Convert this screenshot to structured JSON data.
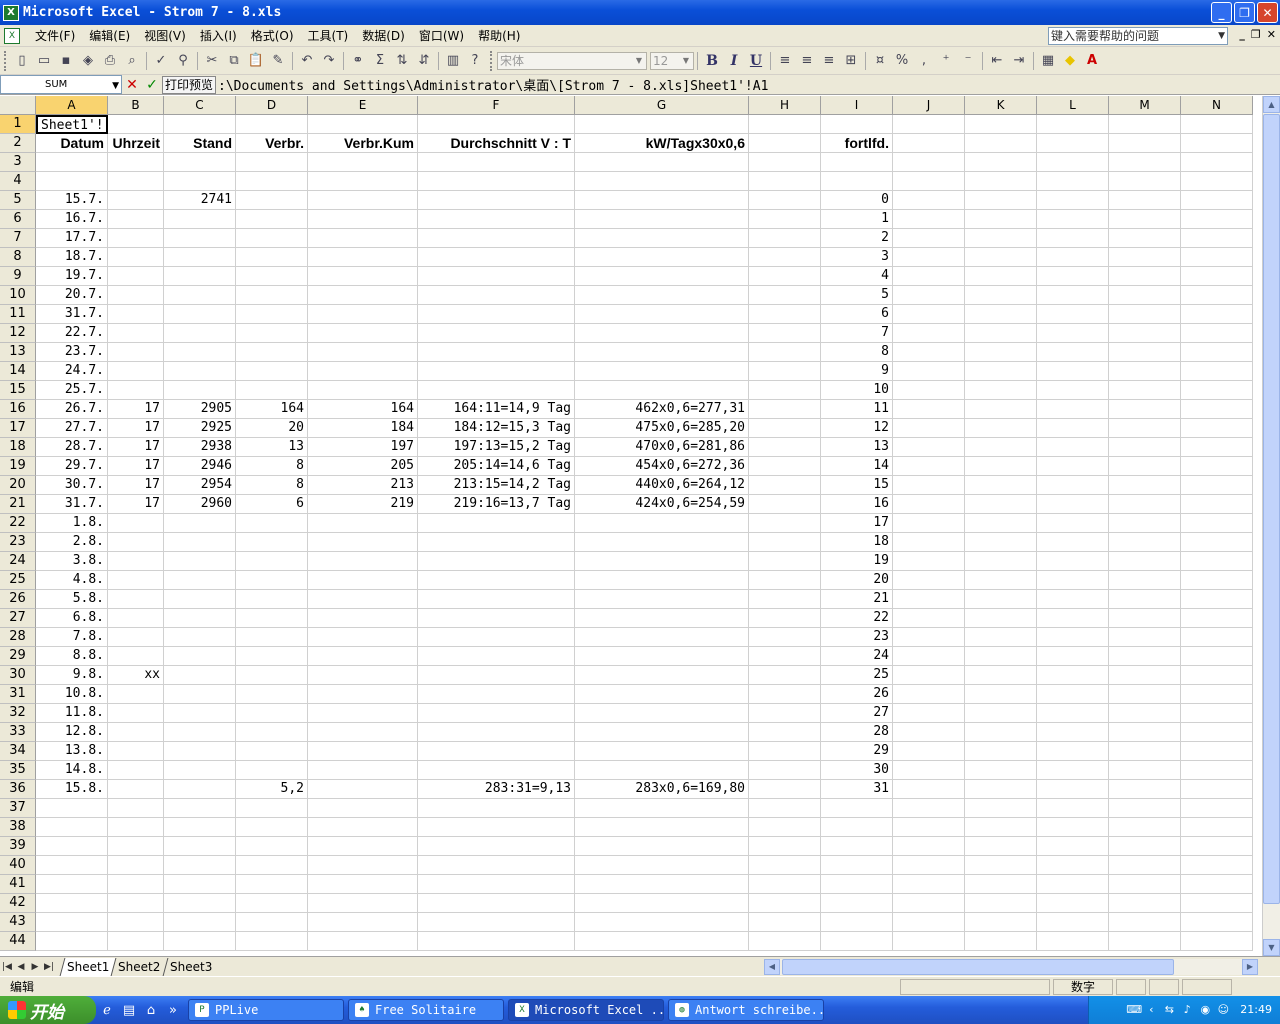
{
  "window": {
    "title": "Microsoft Excel - Strom 7 - 8.xls",
    "app_icon": "excel-icon"
  },
  "menu": {
    "items": [
      "文件(F)",
      "编辑(E)",
      "视图(V)",
      "插入(I)",
      "格式(O)",
      "工具(T)",
      "数据(D)",
      "窗口(W)",
      "帮助(H)"
    ],
    "help_placeholder": "键入需要帮助的问题"
  },
  "toolbar": {
    "font_name": "宋体",
    "font_size": "12",
    "bold": "B",
    "italic": "I",
    "underline": "U",
    "percent": "%"
  },
  "formula_bar": {
    "name_box": "SUM",
    "cancel": "✕",
    "enter": "✓",
    "preview_label": "打印预览",
    "formula": ":\\Documents and Settings\\Administrator\\桌面\\[Strom 7 - 8.xls]Sheet1'!A1"
  },
  "columns": [
    "A",
    "B",
    "C",
    "D",
    "E",
    "F",
    "G",
    "H",
    "I",
    "J",
    "K",
    "L",
    "M",
    "N"
  ],
  "active_column": "A",
  "active_row": "1",
  "rows": [
    {
      "n": "1",
      "cells": {
        "A": "Sheet1'!"
      }
    },
    {
      "n": "2",
      "header": true,
      "cells": {
        "A": "Datum",
        "B": "Uhrzeit",
        "C": "Stand",
        "D": "Verbr.",
        "E": "Verbr.Kum",
        "F": "Durchschnitt V : T",
        "G": "kW/Tagx30x0,6",
        "I": "fortlfd."
      }
    },
    {
      "n": "3",
      "cells": {}
    },
    {
      "n": "4",
      "cells": {}
    },
    {
      "n": "5",
      "cells": {
        "A": "15.7.",
        "C": "2741",
        "I": "0"
      }
    },
    {
      "n": "6",
      "cells": {
        "A": "16.7.",
        "I": "1"
      }
    },
    {
      "n": "7",
      "cells": {
        "A": "17.7.",
        "I": "2"
      }
    },
    {
      "n": "8",
      "cells": {
        "A": "18.7.",
        "I": "3"
      }
    },
    {
      "n": "9",
      "cells": {
        "A": "19.7.",
        "I": "4"
      }
    },
    {
      "n": "10",
      "cells": {
        "A": "20.7.",
        "I": "5"
      }
    },
    {
      "n": "11",
      "cells": {
        "A": "31.7.",
        "I": "6"
      }
    },
    {
      "n": "12",
      "cells": {
        "A": "22.7.",
        "I": "7"
      }
    },
    {
      "n": "13",
      "cells": {
        "A": "23.7.",
        "I": "8"
      }
    },
    {
      "n": "14",
      "cells": {
        "A": "24.7.",
        "I": "9"
      }
    },
    {
      "n": "15",
      "cells": {
        "A": "25.7.",
        "I": "10"
      }
    },
    {
      "n": "16",
      "cells": {
        "A": "26.7.",
        "B": "17",
        "C": "2905",
        "D": "164",
        "E": "164",
        "F": "164:11=14,9 Tag",
        "G": "462x0,6=277,31",
        "I": "11"
      }
    },
    {
      "n": "17",
      "cells": {
        "A": "27.7.",
        "B": "17",
        "C": "2925",
        "D": "20",
        "E": "184",
        "F": "184:12=15,3 Tag",
        "G": "475x0,6=285,20",
        "I": "12"
      }
    },
    {
      "n": "18",
      "cells": {
        "A": "28.7.",
        "B": "17",
        "C": "2938",
        "D": "13",
        "E": "197",
        "F": "197:13=15,2 Tag",
        "G": "470x0,6=281,86",
        "I": "13"
      }
    },
    {
      "n": "19",
      "cells": {
        "A": "29.7.",
        "B": "17",
        "C": "2946",
        "D": "8",
        "E": "205",
        "F": "205:14=14,6 Tag",
        "G": "454x0,6=272,36",
        "I": "14"
      }
    },
    {
      "n": "20",
      "cells": {
        "A": "30.7.",
        "B": "17",
        "C": "2954",
        "D": "8",
        "E": "213",
        "F": "213:15=14,2 Tag",
        "G": "440x0,6=264,12",
        "I": "15"
      }
    },
    {
      "n": "21",
      "cells": {
        "A": "31.7.",
        "B": "17",
        "C": "2960",
        "D": "6",
        "E": "219",
        "F": "219:16=13,7 Tag",
        "G": "424x0,6=254,59",
        "I": "16"
      }
    },
    {
      "n": "22",
      "cells": {
        "A": "1.8.",
        "I": "17"
      }
    },
    {
      "n": "23",
      "cells": {
        "A": "2.8.",
        "I": "18"
      }
    },
    {
      "n": "24",
      "cells": {
        "A": "3.8.",
        "I": "19"
      }
    },
    {
      "n": "25",
      "cells": {
        "A": "4.8.",
        "I": "20"
      }
    },
    {
      "n": "26",
      "cells": {
        "A": "5.8.",
        "I": "21"
      }
    },
    {
      "n": "27",
      "cells": {
        "A": "6.8.",
        "I": "22"
      }
    },
    {
      "n": "28",
      "cells": {
        "A": "7.8.",
        "I": "23"
      }
    },
    {
      "n": "29",
      "cells": {
        "A": "8.8.",
        "I": "24"
      }
    },
    {
      "n": "30",
      "cells": {
        "A": "9.8.",
        "B": "xx",
        "I": "25"
      }
    },
    {
      "n": "31",
      "cells": {
        "A": "10.8.",
        "I": "26"
      }
    },
    {
      "n": "32",
      "cells": {
        "A": "11.8.",
        "I": "27"
      }
    },
    {
      "n": "33",
      "cells": {
        "A": "12.8.",
        "I": "28"
      }
    },
    {
      "n": "34",
      "cells": {
        "A": "13.8.",
        "I": "29"
      }
    },
    {
      "n": "35",
      "cells": {
        "A": "14.8.",
        "I": "30"
      }
    },
    {
      "n": "36",
      "cells": {
        "A": "15.8.",
        "D": "5,2",
        "F": "283:31=9,13",
        "G": "283x0,6=169,80",
        "I": "31"
      }
    },
    {
      "n": "37",
      "cells": {}
    },
    {
      "n": "38",
      "cells": {}
    },
    {
      "n": "39",
      "cells": {}
    },
    {
      "n": "40",
      "cells": {}
    },
    {
      "n": "41",
      "cells": {}
    },
    {
      "n": "42",
      "cells": {}
    },
    {
      "n": "43",
      "cells": {}
    },
    {
      "n": "44",
      "cells": {}
    }
  ],
  "sheets": [
    "Sheet1",
    "Sheet2",
    "Sheet3"
  ],
  "active_sheet": "Sheet1",
  "status": {
    "mode": "编辑",
    "num": "数字"
  },
  "taskbar": {
    "start": "开始",
    "tasks": [
      {
        "label": "PPLive",
        "icon": "pplive-icon"
      },
      {
        "label": "Free Solitaire",
        "icon": "solitaire-icon"
      },
      {
        "label": "Microsoft Excel ...",
        "icon": "excel-icon",
        "active": true
      },
      {
        "label": "Antwort schreibe...",
        "icon": "firefox-icon"
      }
    ],
    "clock": "21:49"
  },
  "colors": {
    "titlebar": "#0a4fd8",
    "chrome": "#ece9d8",
    "active_header": "#f9d36f",
    "taskbar": "#245ddb",
    "start": "#3c8f2b"
  }
}
